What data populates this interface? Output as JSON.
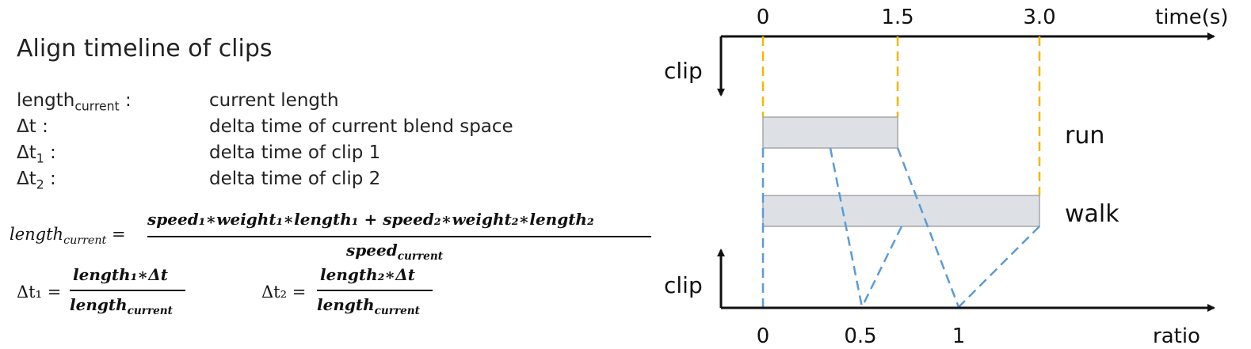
{
  "title": "Align timeline of clips",
  "definitions": [
    {
      "term_base": "length",
      "term_sub": "current",
      "term_suffix": " :",
      "desc": "current length"
    },
    {
      "term_base": "Δt",
      "term_sub": "",
      "term_suffix": " :",
      "desc": "delta time of current blend space"
    },
    {
      "term_base": "Δt",
      "term_sub": "1",
      "term_suffix": " :",
      "desc": "delta time of clip 1"
    },
    {
      "term_base": "Δt",
      "term_sub": "2",
      "term_suffix": " :",
      "desc": "delta time of clip 2"
    }
  ],
  "formulas": {
    "length_lhs": "length",
    "length_lhs_sub": "current",
    "equals": "=",
    "length_numerator": "speed₁∗weight₁∗length₁ + speed₂∗weight₂∗length₂",
    "length_denominator": "speed",
    "length_denominator_sub": "current",
    "dt1_lhs": "Δt₁ =",
    "dt1_numerator": "length₁∗Δt",
    "dt1_denominator": "length",
    "dt1_denominator_sub": "current",
    "dt2_lhs": "Δt₂ =",
    "dt2_numerator": "length₂∗Δt",
    "dt2_denominator": "length",
    "dt2_denominator_sub": "current"
  },
  "diagram": {
    "time_axis_label": "time(s)",
    "time_ticks": [
      "0",
      "1.5",
      "3.0"
    ],
    "ratio_axis_label": "ratio",
    "ratio_ticks": [
      "0",
      "0.5",
      "1"
    ],
    "top_clip_label": "clip",
    "bottom_clip_label": "clip",
    "clips": [
      {
        "name": "run",
        "length": 1.5
      },
      {
        "name": "walk",
        "length": 3.0
      }
    ],
    "colors": {
      "time_guide": "#f2b800",
      "ratio_guide": "#5b9bd5",
      "clip_fill": "#dde1e6",
      "clip_border": "#a6a6a6"
    }
  }
}
